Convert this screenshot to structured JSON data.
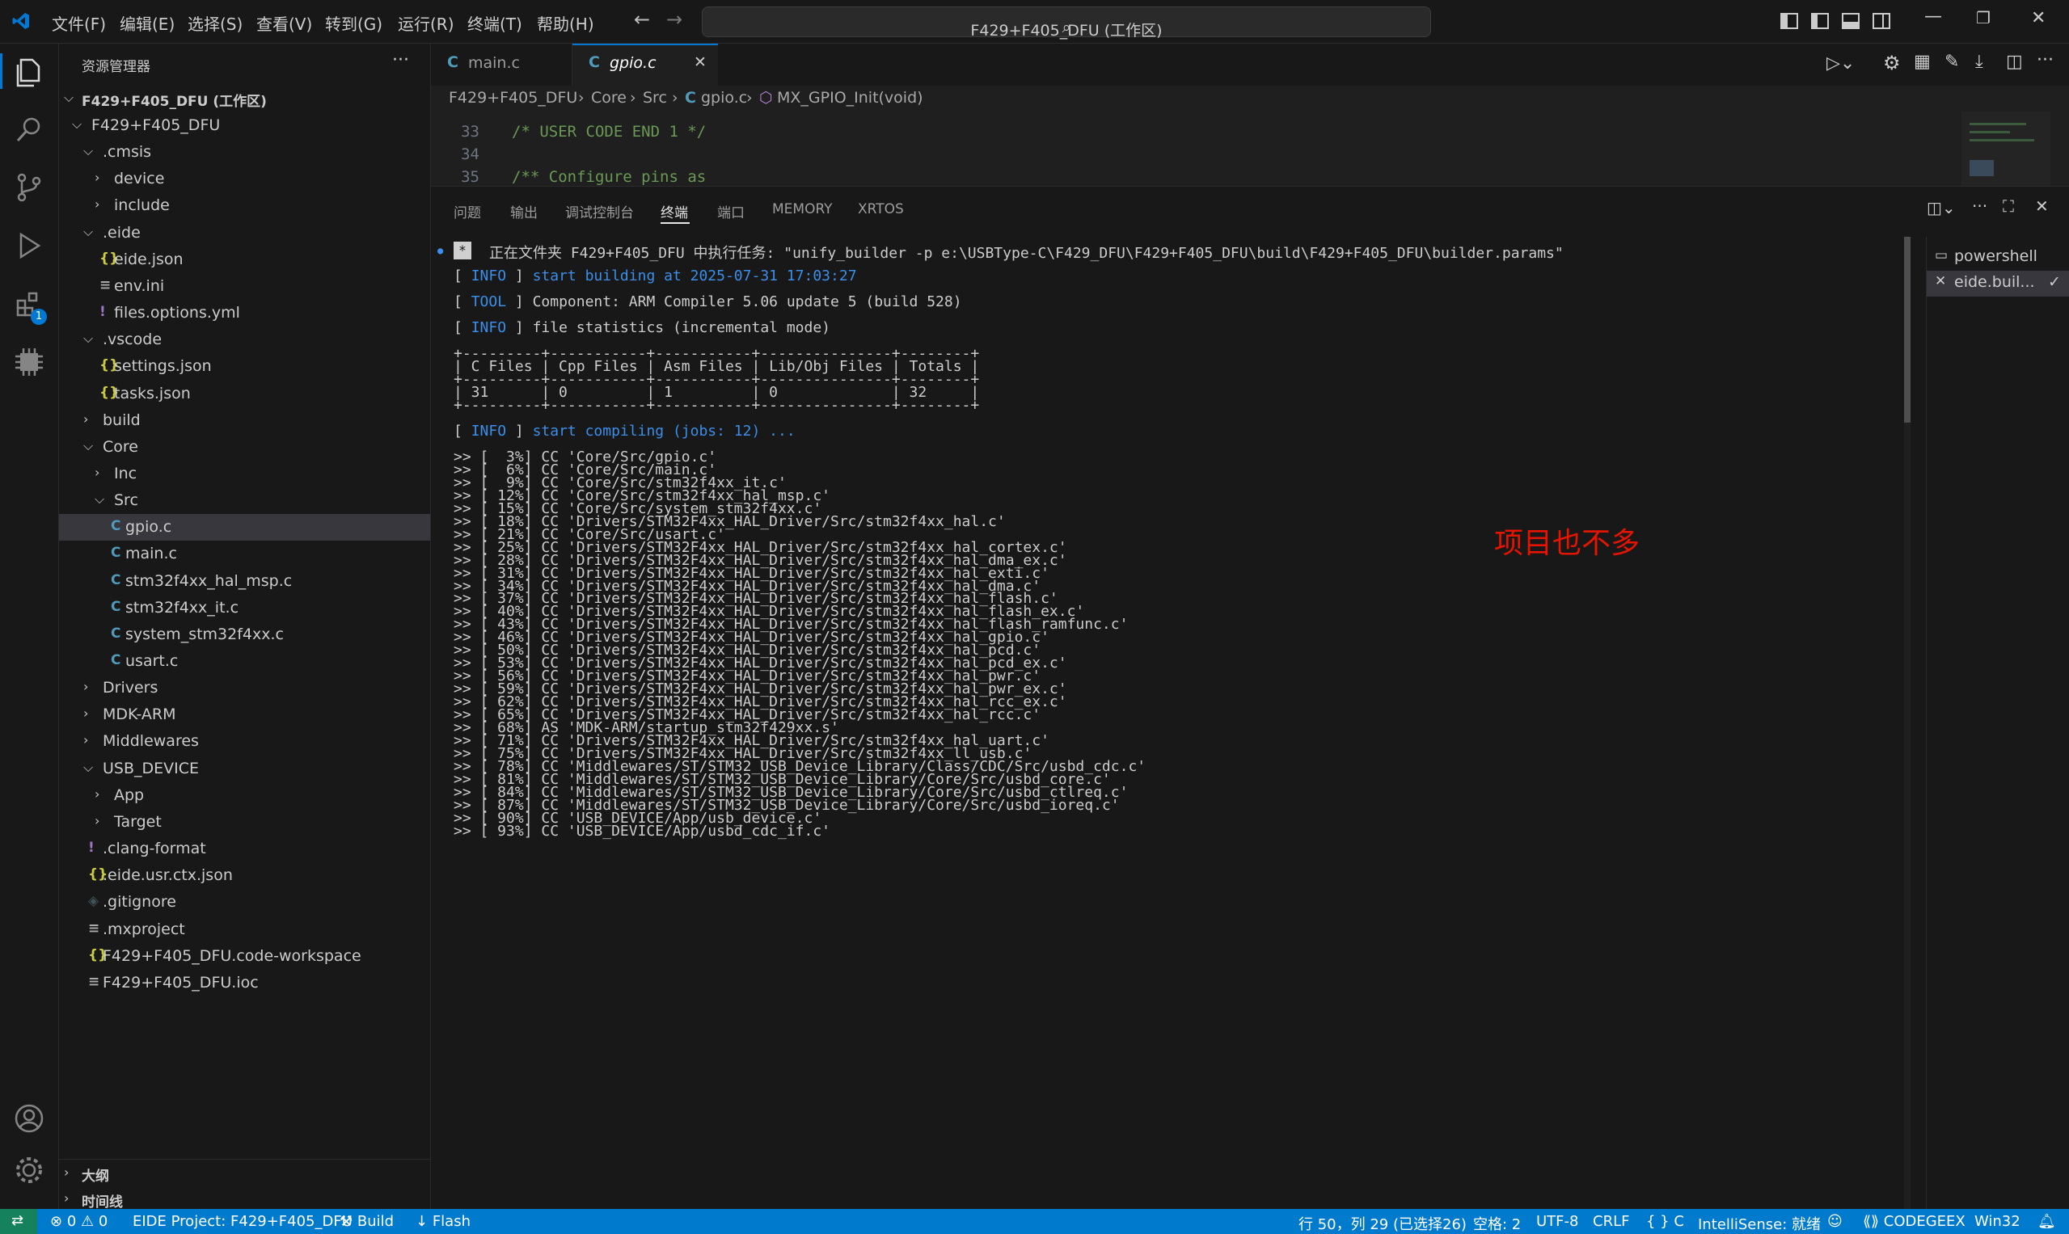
{
  "menu": [
    "文件(F)",
    "编辑(E)",
    "选择(S)",
    "查看(V)",
    "转到(G)",
    "运行(R)",
    "终端(T)",
    "帮助(H)"
  ],
  "search": {
    "text": "F429+F405_DFU (工作区)"
  },
  "sidebar": {
    "title": "资源管理器",
    "more": "···",
    "workspace": "F429+F405_DFU (工作区)",
    "tree": [
      {
        "label": "F429+F405_DFU",
        "type": "folder-open"
      },
      {
        "label": ".cmsis",
        "type": "folder-open"
      },
      {
        "label": "device",
        "type": "folder"
      },
      {
        "label": "include",
        "type": "folder"
      },
      {
        "label": ".eide",
        "type": "folder-open"
      },
      {
        "label": "eide.json",
        "type": "json",
        "icon": "{}"
      },
      {
        "label": "env.ini",
        "type": "ini",
        "icon": "≡"
      },
      {
        "label": "files.options.yml",
        "type": "yml",
        "icon": "!"
      },
      {
        "label": ".vscode",
        "type": "folder-open"
      },
      {
        "label": "settings.json",
        "type": "json",
        "icon": "{}"
      },
      {
        "label": "tasks.json",
        "type": "json",
        "icon": "{}"
      },
      {
        "label": "build",
        "type": "folder"
      },
      {
        "label": "Core",
        "type": "folder-open"
      },
      {
        "label": "Inc",
        "type": "folder"
      },
      {
        "label": "Src",
        "type": "folder-open"
      },
      {
        "label": "gpio.c",
        "type": "c",
        "icon": "C",
        "selected": true
      },
      {
        "label": "main.c",
        "type": "c",
        "icon": "C"
      },
      {
        "label": "stm32f4xx_hal_msp.c",
        "type": "c",
        "icon": "C"
      },
      {
        "label": "stm32f4xx_it.c",
        "type": "c",
        "icon": "C"
      },
      {
        "label": "system_stm32f4xx.c",
        "type": "c",
        "icon": "C"
      },
      {
        "label": "usart.c",
        "type": "c",
        "icon": "C"
      },
      {
        "label": "Drivers",
        "type": "folder"
      },
      {
        "label": "MDK-ARM",
        "type": "folder"
      },
      {
        "label": "Middlewares",
        "type": "folder"
      },
      {
        "label": "USB_DEVICE",
        "type": "folder-open"
      },
      {
        "label": "App",
        "type": "folder"
      },
      {
        "label": "Target",
        "type": "folder"
      },
      {
        "label": ".clang-format",
        "type": "yml",
        "icon": "!"
      },
      {
        "label": ".eide.usr.ctx.json",
        "type": "json",
        "icon": "{}"
      },
      {
        "label": ".gitignore",
        "type": "git",
        "icon": "◈"
      },
      {
        "label": ".mxproject",
        "type": "ini",
        "icon": "≡"
      },
      {
        "label": "F429+F405_DFU.code-workspace",
        "type": "json",
        "icon": "{}"
      },
      {
        "label": "F429+F405_DFU.ioc",
        "type": "ini",
        "icon": "≡"
      }
    ],
    "outline": "大纲",
    "timeline": "时间线"
  },
  "tabs": [
    {
      "icon": "C",
      "label": "main.c"
    },
    {
      "icon": "C",
      "label": "gpio.c",
      "close": "✕"
    }
  ],
  "breadcrumb": [
    "F429+F405_DFU",
    "Core",
    "Src",
    "gpio.c",
    "MX_GPIO_Init(void)"
  ],
  "code": [
    {
      "line": "33",
      "text": "/* USER CODE END 1 */"
    },
    {
      "line": "34",
      "text": ""
    },
    {
      "line": "35",
      "text": "/** Configure pins as"
    }
  ],
  "panel_tabs": [
    "问题",
    "输出",
    "调试控制台",
    "终端",
    "端口",
    "MEMORY",
    "XRTOS"
  ],
  "terminal": {
    "task_line": "正在文件夹 F429+F405_DFU 中执行任务: \"unify_builder -p e:\\USBType-C\\F429_DFU\\F429+F405_DFU\\build\\F429+F405_DFU\\builder.params\"",
    "start_building": "start building at 2025-07-31 17:03:27",
    "component": "Component: ARM Compiler 5.06 update 5 (build 528)",
    "file_stats": "file statistics (incremental mode)",
    "table_border": "+---------+-----------+-----------+---------------+--------+",
    "table_header": "| C Files | Cpp Files | Asm Files | Lib/Obj Files | Totals |",
    "table_values": "| 31      | 0         | 1         | 0             | 32     |",
    "start_compiling": "start compiling (jobs: 12) ...",
    "compile_lines": [
      ">> [  3%] CC 'Core/Src/gpio.c'",
      ">> [  6%] CC 'Core/Src/main.c'",
      ">> [  9%] CC 'Core/Src/stm32f4xx_it.c'",
      ">> [ 12%] CC 'Core/Src/stm32f4xx_hal_msp.c'",
      ">> [ 15%] CC 'Core/Src/system_stm32f4xx.c'",
      ">> [ 18%] CC 'Drivers/STM32F4xx_HAL_Driver/Src/stm32f4xx_hal.c'",
      ">> [ 21%] CC 'Core/Src/usart.c'",
      ">> [ 25%] CC 'Drivers/STM32F4xx_HAL_Driver/Src/stm32f4xx_hal_cortex.c'",
      ">> [ 28%] CC 'Drivers/STM32F4xx_HAL_Driver/Src/stm32f4xx_hal_dma_ex.c'",
      ">> [ 31%] CC 'Drivers/STM32F4xx_HAL_Driver/Src/stm32f4xx_hal_exti.c'",
      ">> [ 34%] CC 'Drivers/STM32F4xx_HAL_Driver/Src/stm32f4xx_hal_dma.c'",
      ">> [ 37%] CC 'Drivers/STM32F4xx_HAL_Driver/Src/stm32f4xx_hal_flash.c'",
      ">> [ 40%] CC 'Drivers/STM32F4xx_HAL_Driver/Src/stm32f4xx_hal_flash_ex.c'",
      ">> [ 43%] CC 'Drivers/STM32F4xx_HAL_Driver/Src/stm32f4xx_hal_flash_ramfunc.c'",
      ">> [ 46%] CC 'Drivers/STM32F4xx_HAL_Driver/Src/stm32f4xx_hal_gpio.c'",
      ">> [ 50%] CC 'Drivers/STM32F4xx_HAL_Driver/Src/stm32f4xx_hal_pcd.c'",
      ">> [ 53%] CC 'Drivers/STM32F4xx_HAL_Driver/Src/stm32f4xx_hal_pcd_ex.c'",
      ">> [ 56%] CC 'Drivers/STM32F4xx_HAL_Driver/Src/stm32f4xx_hal_pwr.c'",
      ">> [ 59%] CC 'Drivers/STM32F4xx_HAL_Driver/Src/stm32f4xx_hal_pwr_ex.c'",
      ">> [ 62%] CC 'Drivers/STM32F4xx_HAL_Driver/Src/stm32f4xx_hal_rcc_ex.c'",
      ">> [ 65%] CC 'Drivers/STM32F4xx_HAL_Driver/Src/stm32f4xx_hal_rcc.c'",
      ">> [ 68%] AS 'MDK-ARM/startup_stm32f429xx.s'",
      ">> [ 71%] CC 'Drivers/STM32F4xx_HAL_Driver/Src/stm32f4xx_hal_uart.c'",
      ">> [ 75%] CC 'Drivers/STM32F4xx_HAL_Driver/Src/stm32f4xx_ll_usb.c'",
      ">> [ 78%] CC 'Middlewares/ST/STM32_USB_Device_Library/Class/CDC/Src/usbd_cdc.c'",
      ">> [ 81%] CC 'Middlewares/ST/STM32_USB_Device_Library/Core/Src/usbd_core.c'",
      ">> [ 84%] CC 'Middlewares/ST/STM32_USB_Device_Library/Core/Src/usbd_ctlreq.c'",
      ">> [ 87%] CC 'Middlewares/ST/STM32_USB_Device_Library/Core/Src/usbd_ioreq.c'",
      ">> [ 90%] CC 'USB_DEVICE/App/usb_device.c'",
      ">> [ 93%] CC 'USB_DEVICE/App/usbd_cdc_if.c'"
    ],
    "tags": {
      "info": "INFO",
      "tool": "TOOL"
    },
    "annotation": "项目也不多"
  },
  "terminal_list": [
    {
      "label": "powershell"
    },
    {
      "label": "eide.buil...",
      "check": "✓"
    }
  ],
  "statusbar": {
    "errors": "0",
    "warnings": "0",
    "project": "EIDE Project: F429+F405_DFU",
    "build": "Build",
    "flash": "Flash",
    "position": "行 50，列 29 (已选择26)",
    "spaces": "空格: 2",
    "encoding": "UTF-8",
    "eol": "CRLF",
    "lang": "{ } C",
    "intellisense": "IntelliSense: 就绪",
    "codegeex": "CODEGEEX",
    "platform": "Win32"
  },
  "badges": {
    "extensions": "1"
  },
  "colors": {
    "accent": "#007acc",
    "info": "#3b8eea",
    "annotation": "#e51400",
    "comment": "#6a9955"
  }
}
